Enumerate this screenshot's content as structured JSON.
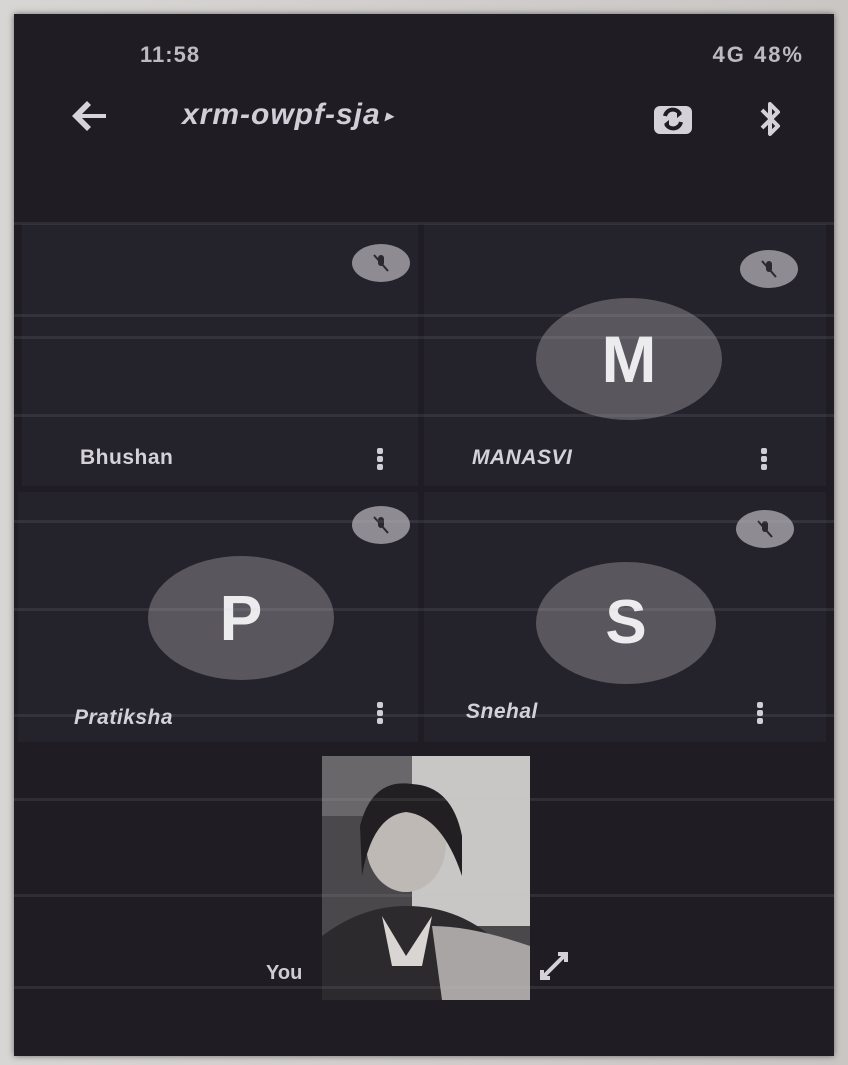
{
  "status_bar": {
    "time": "11:58",
    "right_indicators": "4G 48%"
  },
  "header": {
    "meeting_code": "xrm-owpf-sja",
    "back_icon": "arrow-back-icon",
    "switch_camera_icon": "switch-camera-icon",
    "bluetooth_icon": "bluetooth-icon"
  },
  "participants": [
    {
      "name": "Bhushan",
      "avatar": "photo",
      "muted": true
    },
    {
      "name": "MANASVI",
      "avatar_letter": "M",
      "muted": true
    },
    {
      "name": "Pratiksha",
      "avatar_letter": "P",
      "muted": true
    },
    {
      "name": "Snehal",
      "avatar_letter": "S",
      "muted": true
    }
  ],
  "self_view": {
    "label": "You",
    "icon": "unpin-icon"
  },
  "colors": {
    "screen_bg": "#1f1d23",
    "tile_bg": "#24222a",
    "avatar_bg": "#5a565d",
    "mic_badge": "#8e8c92"
  }
}
